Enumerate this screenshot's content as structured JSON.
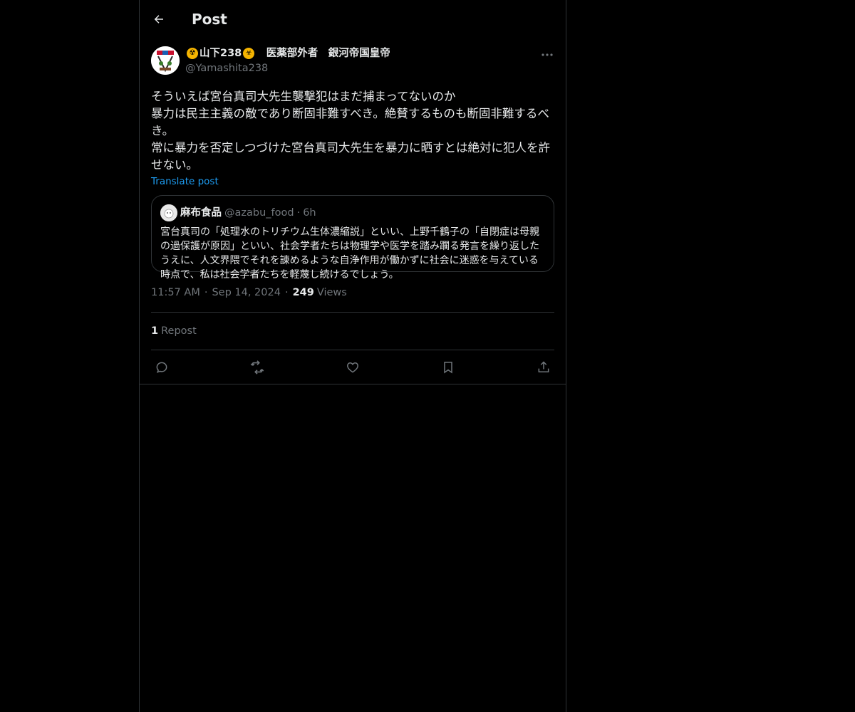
{
  "header": {
    "title": "Post"
  },
  "author": {
    "display_name": "山下238",
    "title_text": "医薬部外者　銀河帝国皇帝",
    "handle": "@Yamashita238"
  },
  "post": {
    "text": "そういえば宮台真司大先生襲撃犯はまだ捕まってないのか\n暴力は民主主義の敵であり断固非難すべき。絶賛するものも断固非難するべき。\n常に暴力を否定しつづけた宮台真司大先生を暴力に晒すとは絶対に犯人を許せない。",
    "translate_label": "Translate post"
  },
  "quote": {
    "name": "麻布食品",
    "handle": "@azabu_food",
    "dot": "·",
    "time": "6h",
    "text": "宮台真司の「処理水のトリチウム生体濃縮説」といい、上野千鶴子の「自閉症は母親の過保護が原因」といい、社会学者たちは物理学や医学を踏み躙る発言を繰り返したうえに、人文界隈でそれを諌めるような自浄作用が働かずに社会に迷惑を与えている時点で、私は社会学者たちを軽蔑し続けるでしょう。"
  },
  "meta": {
    "time": "11:57 AM",
    "sep": "·",
    "date": "Sep 14, 2024",
    "views_count": "249",
    "views_label": "Views"
  },
  "stats": {
    "repost_count": "1",
    "repost_label": "Repost"
  },
  "colors": {
    "background": "#000000",
    "text": "#e7e9ea",
    "muted": "#71767b",
    "accent": "#1d9bf0",
    "border": "#2f3336"
  },
  "icons": {
    "back": "arrow-left-icon",
    "more": "more-horizontal-icon",
    "reply": "reply-icon",
    "repost": "repost-icon",
    "like": "heart-icon",
    "bookmark": "bookmark-icon",
    "share": "share-icon"
  }
}
